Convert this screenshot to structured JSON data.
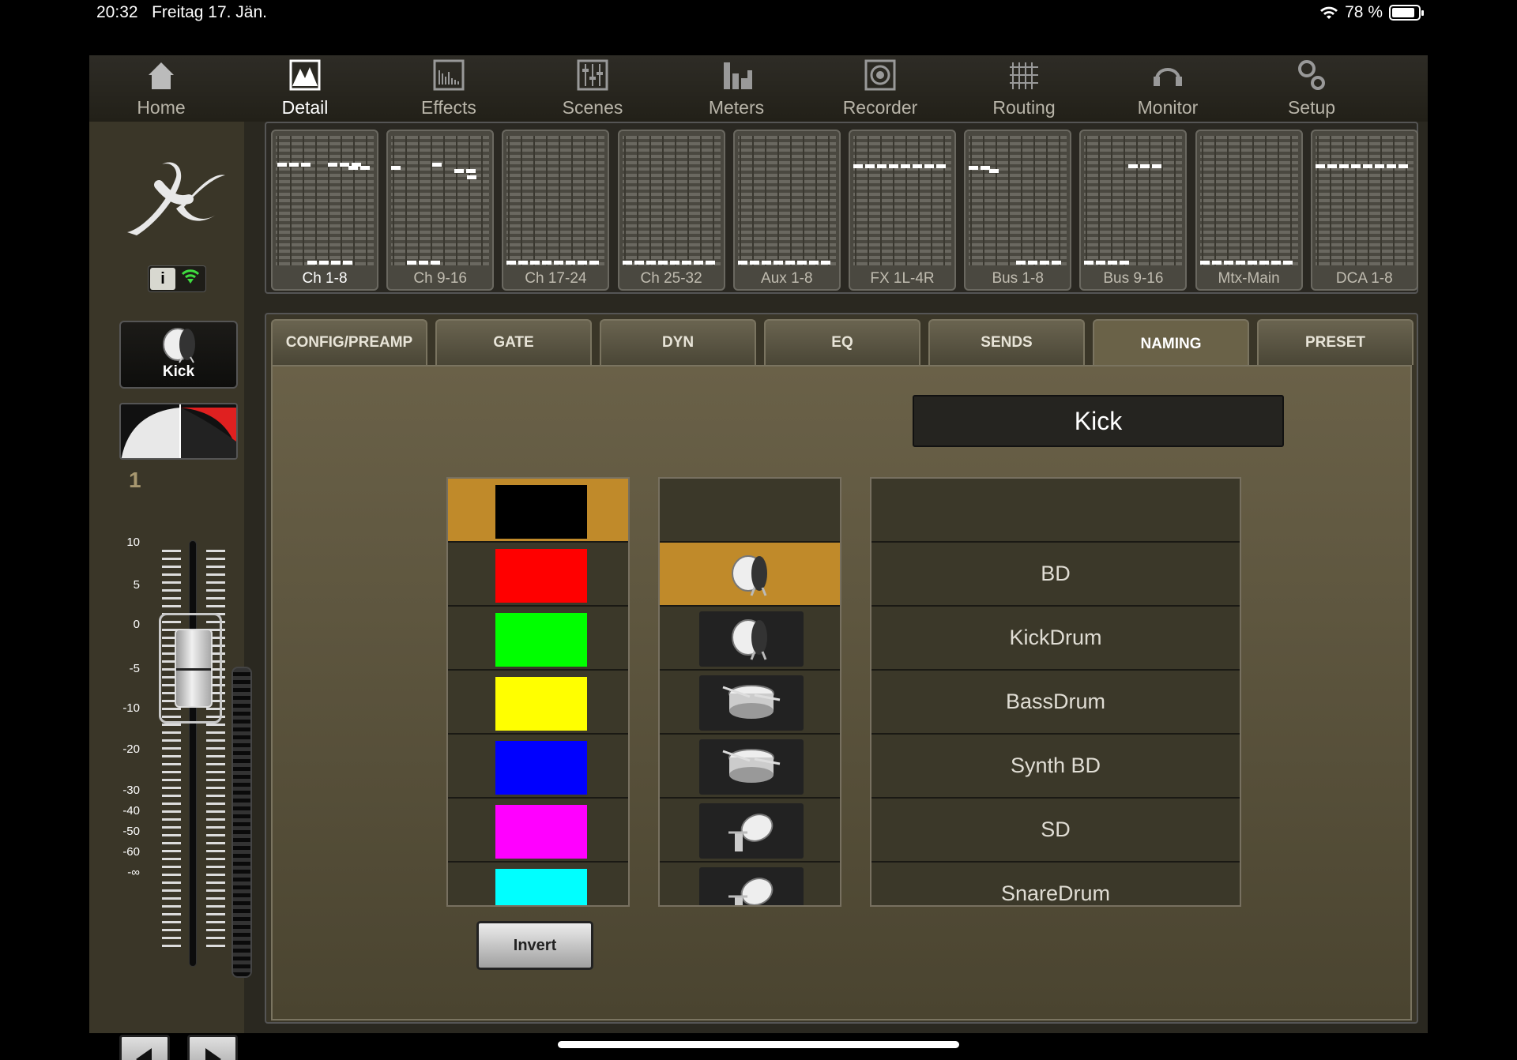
{
  "status": {
    "time": "20:32",
    "date": "Freitag 17. Jän.",
    "battery": "78 %"
  },
  "nav": [
    {
      "label": "Home",
      "icon": "home-icon",
      "active": false
    },
    {
      "label": "Detail",
      "icon": "detail-icon",
      "active": true
    },
    {
      "label": "Effects",
      "icon": "effects-icon",
      "active": false
    },
    {
      "label": "Scenes",
      "icon": "scenes-icon",
      "active": false
    },
    {
      "label": "Meters",
      "icon": "meters-icon",
      "active": false
    },
    {
      "label": "Recorder",
      "icon": "recorder-icon",
      "active": false
    },
    {
      "label": "Routing",
      "icon": "routing-icon",
      "active": false
    },
    {
      "label": "Monitor",
      "icon": "monitor-icon",
      "active": false
    },
    {
      "label": "Setup",
      "icon": "setup-icon",
      "active": false
    }
  ],
  "sidebar": {
    "info_label": "i",
    "channel_name": "Kick",
    "channel_number": "1",
    "scale": [
      "10",
      "5",
      "0",
      "-5",
      "-10",
      "-20",
      "-30",
      "-40",
      "-50",
      "-60",
      "-∞"
    ]
  },
  "overview": [
    {
      "label": "Ch 1-8",
      "active": true
    },
    {
      "label": "Ch 9-16",
      "active": false
    },
    {
      "label": "Ch 17-24",
      "active": false
    },
    {
      "label": "Ch 25-32",
      "active": false
    },
    {
      "label": "Aux 1-8",
      "active": false
    },
    {
      "label": "FX 1L-4R",
      "active": false
    },
    {
      "label": "Bus 1-8",
      "active": false
    },
    {
      "label": "Bus 9-16",
      "active": false
    },
    {
      "label": "Mtx-Main",
      "active": false
    },
    {
      "label": "DCA 1-8",
      "active": false
    }
  ],
  "tabs": [
    {
      "label": "CONFIG/PREAMP",
      "active": false
    },
    {
      "label": "GATE",
      "active": false
    },
    {
      "label": "DYN",
      "active": false
    },
    {
      "label": "EQ",
      "active": false
    },
    {
      "label": "SENDS",
      "active": false
    },
    {
      "label": "NAMING",
      "active": true
    },
    {
      "label": "PRESET",
      "active": false
    }
  ],
  "naming": {
    "name_value": "Kick",
    "colors": [
      "#000000",
      "#ff0000",
      "#00ff00",
      "#ffff00",
      "#0000ff",
      "#ff00ff",
      "#00ffff"
    ],
    "selected_color_index": 0,
    "icons": [
      "",
      "kick-drum-icon",
      "kick-drum-icon",
      "snare-drum-icon",
      "snare-drum-icon",
      "tom-drum-icon",
      "tom-drum-icon"
    ],
    "selected_icon_index": 1,
    "names": [
      "",
      "BD",
      "KickDrum",
      "BassDrum",
      "Synth BD",
      "SD",
      "SnareDrum"
    ],
    "invert_label": "Invert"
  },
  "accent_color": "#c08a2a"
}
